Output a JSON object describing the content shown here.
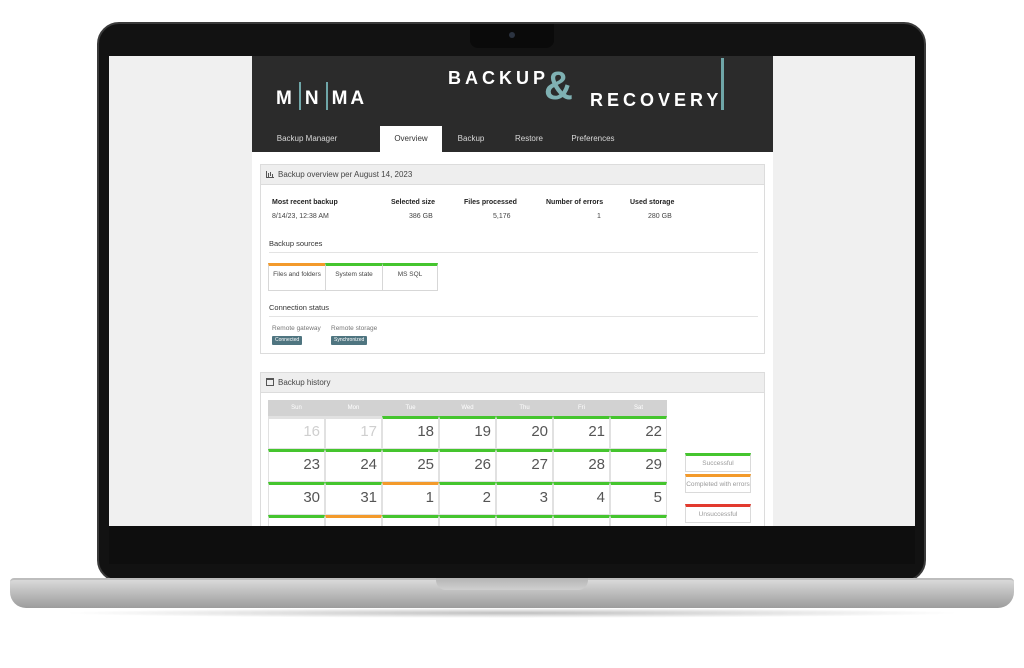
{
  "brand": {
    "logo": "MINIMA",
    "title_backup": "BACKUP",
    "title_amp": "&",
    "title_recovery": "RECOVERY"
  },
  "nav": {
    "items": [
      {
        "label": "Backup Manager"
      },
      {
        "label": "Overview",
        "active": true
      },
      {
        "label": "Backup"
      },
      {
        "label": "Restore"
      },
      {
        "label": "Preferences"
      }
    ]
  },
  "overview": {
    "title": "Backup overview per August 14, 2023",
    "stats": [
      {
        "label": "Most recent backup",
        "value": "8/14/23, 12:38 AM"
      },
      {
        "label": "Selected size",
        "value": "386 GB"
      },
      {
        "label": "Files processed",
        "value": "5,176"
      },
      {
        "label": "Number of errors",
        "value": "1"
      },
      {
        "label": "Used storage",
        "value": "280 GB"
      }
    ],
    "sources_title": "Backup sources",
    "sources": [
      {
        "label": "Files and folders",
        "status_color": "#f39a2b"
      },
      {
        "label": "System state",
        "status_color": "#45c52e"
      },
      {
        "label": "MS SQL",
        "status_color": "#45c52e"
      }
    ],
    "connection_title": "Connection status",
    "connections": [
      {
        "label": "Remote gateway",
        "badge": "Connected"
      },
      {
        "label": "Remote storage",
        "badge": "Synchronized"
      }
    ]
  },
  "history": {
    "title": "Backup history",
    "weekdays": [
      "Sun",
      "Mon",
      "Tue",
      "Wed",
      "Thu",
      "Fri",
      "Sat"
    ],
    "weeks": [
      [
        {
          "day": "16",
          "muted": true,
          "status": "none"
        },
        {
          "day": "17",
          "muted": true,
          "status": "none"
        },
        {
          "day": "18",
          "status": "success"
        },
        {
          "day": "19",
          "status": "success"
        },
        {
          "day": "20",
          "status": "success"
        },
        {
          "day": "21",
          "status": "success"
        },
        {
          "day": "22",
          "status": "success"
        }
      ],
      [
        {
          "day": "23",
          "status": "success"
        },
        {
          "day": "24",
          "status": "success"
        },
        {
          "day": "25",
          "status": "success"
        },
        {
          "day": "26",
          "status": "success"
        },
        {
          "day": "27",
          "status": "success"
        },
        {
          "day": "28",
          "status": "success"
        },
        {
          "day": "29",
          "status": "success"
        }
      ],
      [
        {
          "day": "30",
          "status": "success"
        },
        {
          "day": "31",
          "status": "success"
        },
        {
          "day": "1",
          "status": "warning"
        },
        {
          "day": "2",
          "status": "success"
        },
        {
          "day": "3",
          "status": "success"
        },
        {
          "day": "4",
          "status": "success"
        },
        {
          "day": "5",
          "status": "success"
        }
      ],
      [
        {
          "day": "",
          "status": "success"
        },
        {
          "day": "",
          "status": "warning"
        },
        {
          "day": "",
          "status": "success"
        },
        {
          "day": "",
          "status": "success"
        },
        {
          "day": "",
          "status": "success"
        },
        {
          "day": "",
          "status": "success"
        },
        {
          "day": "",
          "status": "success"
        }
      ]
    ],
    "legend": [
      {
        "label": "Successful",
        "color": "#45c52e"
      },
      {
        "label": "Completed with errors",
        "color": "#f39a2b"
      },
      {
        "label": "Unsuccessful",
        "color": "#e23a2e"
      }
    ]
  },
  "colors": {
    "success": "#45c52e",
    "warning": "#f39a2b",
    "error": "#e23a2e",
    "header_bg": "#2b2b2b",
    "accent": "#6fa6a8"
  }
}
